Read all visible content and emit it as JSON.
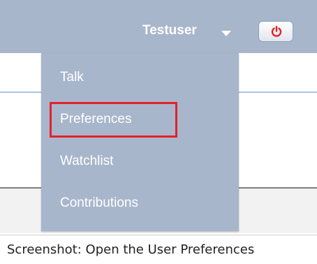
{
  "header": {
    "username": "Testuser",
    "dropdown_icon": "chevron-down-icon",
    "logout_icon": "power-icon",
    "power_color": "#e5202b"
  },
  "user_menu": {
    "items": [
      {
        "label": "Talk"
      },
      {
        "label": "Preferences",
        "highlighted": true
      },
      {
        "label": "Watchlist"
      },
      {
        "label": "Contributions"
      }
    ],
    "highlight_color": "#e5202b"
  },
  "caption": "Screenshot: Open the User Preferences",
  "colors": {
    "header_bg": "#a8b6cc",
    "menu_bg": "#a8b6cc",
    "menu_text": "#ffffff"
  }
}
